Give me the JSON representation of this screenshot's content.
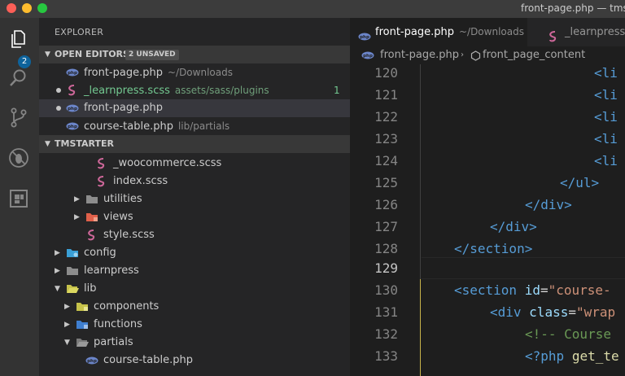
{
  "window": {
    "title": "front-page.php — tmst"
  },
  "activity_bar": {
    "explorer_badge": "2"
  },
  "sidebar": {
    "title": "EXPLORER",
    "open_editors": {
      "label": "OPEN EDITORS",
      "unsaved": "2 UNSAVED",
      "items": [
        {
          "name": "front-page.php",
          "desc": "~/Downloads"
        },
        {
          "name": "_learnpress.scss",
          "desc": "assets/sass/plugins",
          "count": "1"
        },
        {
          "name": "front-page.php",
          "desc": ""
        },
        {
          "name": "course-table.php",
          "desc": "lib/partials"
        }
      ]
    },
    "project": {
      "label": "TMSTARTER",
      "items": [
        {
          "name": "_woocommerce.scss"
        },
        {
          "name": "index.scss"
        },
        {
          "name": "utilities"
        },
        {
          "name": "views"
        },
        {
          "name": "style.scss"
        },
        {
          "name": "config"
        },
        {
          "name": "learnpress"
        },
        {
          "name": "lib"
        },
        {
          "name": "components"
        },
        {
          "name": "functions"
        },
        {
          "name": "partials"
        },
        {
          "name": "course-table.php"
        }
      ]
    }
  },
  "editor": {
    "tabs": [
      {
        "name": "front-page.php",
        "desc": "~/Downloads"
      },
      {
        "name": "_learnpress.scss",
        "desc": ""
      }
    ],
    "breadcrumb": {
      "file": "front-page.php",
      "symbol": "front_page_content"
    },
    "line_numbers": [
      "120",
      "121",
      "122",
      "123",
      "124",
      "125",
      "126",
      "127",
      "128",
      "129",
      "130",
      "131",
      "132",
      "133"
    ],
    "code": {
      "l120": "<li",
      "l121": "<li",
      "l122": "<li",
      "l123": "<li",
      "l124": "<li",
      "l125": "</ul>",
      "l126": "</div>",
      "l127": "</div>",
      "l128": "</section>",
      "l130_tag": "<section",
      "l130_attr": "id",
      "l130_eq": "=",
      "l130_str": "\"course-",
      "l131_tag": "<div",
      "l131_attr": "class",
      "l131_eq": "=",
      "l131_str": "\"wrap",
      "l132": "<!-- Course",
      "l133_tag": "<?php",
      "l133_fn": "get_te"
    }
  },
  "colors": {
    "accent": "#0e639c",
    "modified": "#73c991",
    "php_icon": "#6b85c9",
    "sass_icon": "#cd6799"
  }
}
